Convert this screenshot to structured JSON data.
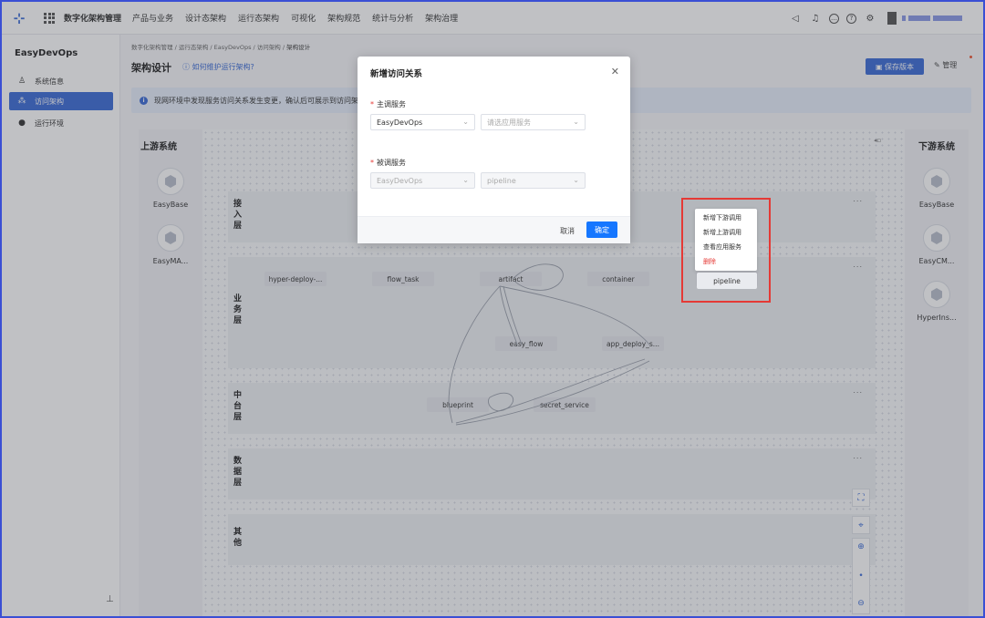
{
  "topnav": {
    "app_name": "数字化架构管理",
    "items": [
      "产品与业务",
      "设计态架构",
      "运行态架构",
      "可视化",
      "架构规范",
      "统计与分析",
      "架构治理"
    ]
  },
  "sidebar": {
    "title": "EasyDevOps",
    "items": [
      {
        "label": "系统信息",
        "icon": "user-icon"
      },
      {
        "label": "访问架构",
        "icon": "architecture-icon"
      },
      {
        "label": "运行环境",
        "icon": "location-icon"
      }
    ]
  },
  "main": {
    "breadcrumb": [
      "数字化架构管理",
      "运行态架构",
      "EasyDevOps",
      "访问架构",
      "架构设计"
    ],
    "title": "架构设计",
    "help_link": "如何维护运行架构?",
    "save_label": "保存版本",
    "manage_label": "管理",
    "alert": "现网环境中发现服务访问关系发生变更，确认后可展示到访问架构"
  },
  "canvas": {
    "upstream_title": "上游系统",
    "downstream_title": "下游系统",
    "upstream": [
      "EasyBase",
      "EasyMA..."
    ],
    "downstream": [
      "EasyBase",
      "EasyCM...",
      "HyperIns..."
    ],
    "layers": [
      {
        "name": "接入层",
        "nodes": []
      },
      {
        "name": "业务层",
        "nodes": [
          "hyper-deploy-...",
          "flow_task",
          "artifact",
          "container",
          "pipeline",
          "easy_flow",
          "app_deploy_s..."
        ]
      },
      {
        "name": "中台层",
        "nodes": [
          "blueprint",
          "secret_service"
        ]
      },
      {
        "name": "数据层",
        "nodes": []
      },
      {
        "name": "其他",
        "nodes": []
      }
    ],
    "more": "..."
  },
  "context_menu": {
    "items": [
      "新增下游调用",
      "新增上游调用",
      "查看应用服务"
    ],
    "danger": "删除"
  },
  "modal": {
    "title": "新增访问关系",
    "caller_label": "主调服务",
    "caller_system": "EasyDevOps",
    "caller_service_placeholder": "请选应用服务",
    "callee_label": "被调服务",
    "callee_system": "EasyDevOps",
    "callee_service": "pipeline",
    "cancel": "取消",
    "confirm": "确定"
  }
}
